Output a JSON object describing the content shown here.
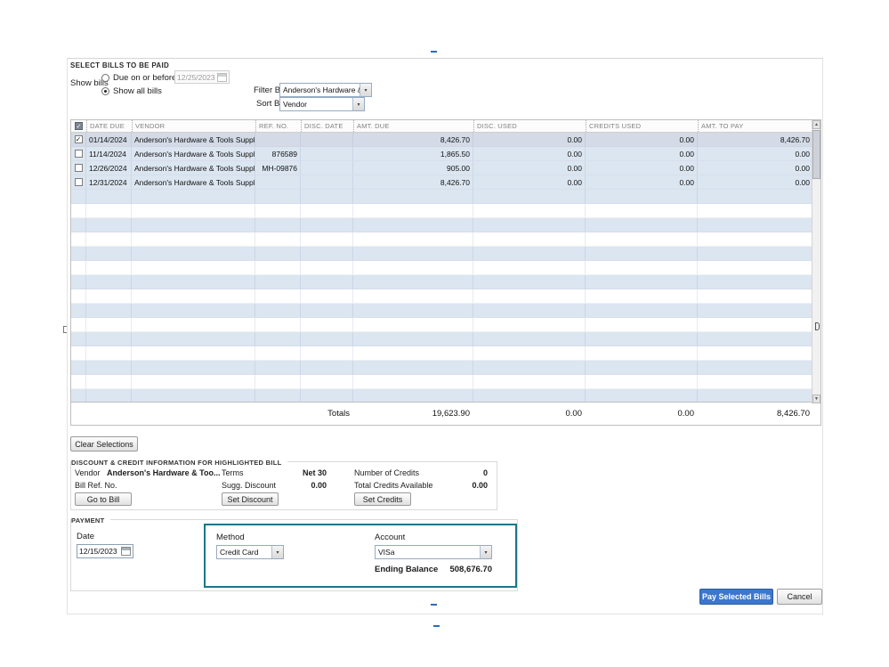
{
  "colors": {
    "accent_teal": "#19768a",
    "primary_button_blue": "#3c77cc",
    "row_stripe_blue": "#dce6f1",
    "selected_row": "#d4dbe7"
  },
  "dialog": {
    "title": "SELECT BILLS TO BE PAID"
  },
  "show_bills": {
    "label": "Show bills",
    "due_option": "Due on or before",
    "due_date": "12/25/2023",
    "all_option": "Show all bills"
  },
  "filters": {
    "filter_by_label": "Filter By",
    "filter_by_value": "Anderson's Hardware & ...",
    "sort_by_label": "Sort By",
    "sort_by_value": "Vendor"
  },
  "table": {
    "columns": [
      "DATE DUE",
      "VENDOR",
      "REF. NO.",
      "DISC. DATE",
      "AMT. DUE",
      "DISC. USED",
      "CREDITS USED",
      "AMT. TO PAY"
    ],
    "rows": [
      {
        "checked": true,
        "cells": [
          "01/14/2024",
          "Anderson's Hardware & Tools Supply",
          "",
          "",
          "8,426.70",
          "0.00",
          "0.00",
          "8,426.70"
        ]
      },
      {
        "checked": false,
        "cells": [
          "11/14/2024",
          "Anderson's Hardware & Tools Supply",
          "876589",
          "",
          "1,865.50",
          "0.00",
          "0.00",
          "0.00"
        ]
      },
      {
        "checked": false,
        "cells": [
          "12/26/2024",
          "Anderson's Hardware & Tools Supply",
          "MH-09876",
          "",
          "905.00",
          "0.00",
          "0.00",
          "0.00"
        ]
      },
      {
        "checked": false,
        "cells": [
          "12/31/2024",
          "Anderson's Hardware & Tools Supply",
          "",
          "",
          "8,426.70",
          "0.00",
          "0.00",
          "0.00"
        ]
      }
    ],
    "totals": {
      "label": "Totals",
      "amt_due": "19,623.90",
      "disc_used": "0.00",
      "credits_used": "0.00",
      "amt_to_pay": "8,426.70"
    }
  },
  "actions": {
    "clear_selections": "Clear Selections"
  },
  "discount_credit": {
    "title": "DISCOUNT & CREDIT INFORMATION FOR HIGHLIGHTED BILL",
    "vendor_label": "Vendor",
    "vendor_value": "Anderson's Hardware & Too...",
    "bill_ref_label": "Bill Ref. No.",
    "go_to_bill": "Go to Bill",
    "terms_label": "Terms",
    "terms_value": "Net 30",
    "sugg_discount_label": "Sugg. Discount",
    "sugg_discount_value": "0.00",
    "set_discount": "Set Discount",
    "number_of_credits_label": "Number of Credits",
    "number_of_credits_value": "0",
    "total_credits_label": "Total Credits Available",
    "total_credits_value": "0.00",
    "set_credits": "Set Credits"
  },
  "payment": {
    "title": "PAYMENT",
    "date_label": "Date",
    "date_value": "12/15/2023",
    "method_label": "Method",
    "method_value": "Credit Card",
    "account_label": "Account",
    "account_value": "VISa",
    "ending_balance_label": "Ending Balance",
    "ending_balance_value": "508,676.70"
  },
  "footer": {
    "pay_selected_bills": "Pay Selected Bills",
    "cancel": "Cancel"
  }
}
